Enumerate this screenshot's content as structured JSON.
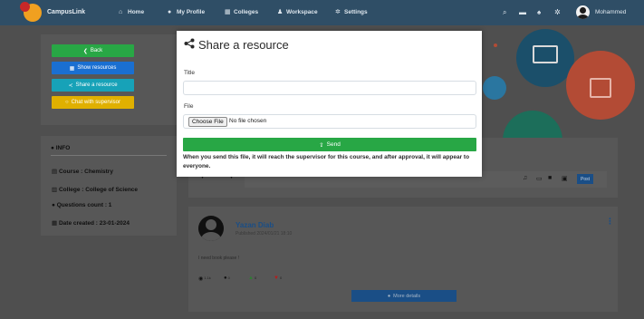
{
  "nav": {
    "brand": "CampusLink",
    "items": [
      {
        "label": "Home",
        "icon": "home-icon"
      },
      {
        "label": "My Profile",
        "icon": "user-icon"
      },
      {
        "label": "Colleges",
        "icon": "building-icon"
      },
      {
        "label": "Workspace",
        "icon": "users-icon"
      },
      {
        "label": "Settings",
        "icon": "gear-icon"
      }
    ],
    "user_name": "Mohammed"
  },
  "sidebar": {
    "buttons": [
      {
        "label": "Back",
        "color": "#28a745"
      },
      {
        "label": "Show resources",
        "color": "#1a6fd1"
      },
      {
        "label": "Share a resource",
        "color": "#17a2b8"
      },
      {
        "label": "Chat with supervisor",
        "color": "#e0b000"
      }
    ],
    "info_title": "INFO",
    "info_items": [
      "Course : Chemistry",
      "College : College of Science",
      "Questions count : 1",
      "Date created : 23-01-2024"
    ]
  },
  "composer": {
    "post_label": "Post"
  },
  "post": {
    "author": "Yazan Diab",
    "published": "Published 2024/01/21 18:10",
    "body": "I need book please !",
    "stats": {
      "views": "1.1k",
      "comments": "0",
      "likes": "0",
      "dislikes": "0"
    },
    "more_label": "More details"
  },
  "modal": {
    "title": "Share a resource",
    "title_label": "Title",
    "title_value": "",
    "file_label": "File",
    "choose_file": "Choose File",
    "file_status": "No file chosen",
    "send_label": "Send",
    "note": "When you send this file, it will reach the supervisor for this course, and after approval, it will appear to everyone."
  },
  "colors": {
    "accent": "#1a4e86",
    "success": "#28a745",
    "nav": "#2f4e66"
  }
}
